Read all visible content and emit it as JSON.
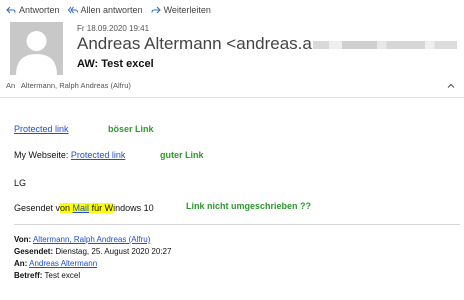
{
  "toolbar": {
    "reply": "Antworten",
    "reply_all": "Allen antworten",
    "forward": "Weiterleiten"
  },
  "header": {
    "date": "Fr 18.09.2020 19:41",
    "sender": "Andreas Altermann <andreas.a",
    "subject": "AW: Test excel",
    "to_label": "An",
    "to_value": "Altermann, Ralph Andreas (Alfru)"
  },
  "body": {
    "link1": "Protected link",
    "note1": "böser Link",
    "line2_prefix": "My Webseite: ",
    "link2": "Protected link",
    "note2": "guter Link",
    "greeting": "LG",
    "sent_pre": "Gesendet v",
    "sent_hl1": "on ",
    "sent_link": "Mail",
    "sent_mid": " für ",
    "sent_hl2": "W",
    "sent_post": "indows 10",
    "note3": "Link nicht umgeschrieben ??"
  },
  "quoted": {
    "from_label": "Von:",
    "from_value": "Altermann, Ralph Andreas (Alfru)",
    "sent_label": "Gesendet:",
    "sent_value": "Dienstag, 25. August 2020 20:27",
    "to_label": "An:",
    "to_value": "Andreas Altermann",
    "subject_label": "Betreff:",
    "subject_value": "Test excel"
  },
  "colors": {
    "link": "#1f4fd0",
    "annotation": "#2e9a2e",
    "highlight": "#ffff00"
  }
}
